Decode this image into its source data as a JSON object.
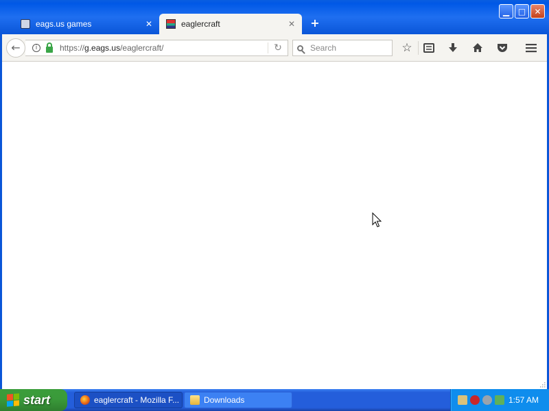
{
  "window": {
    "controls": {
      "minimize": "▁",
      "maximize": "□",
      "close": "✕"
    }
  },
  "tabs": [
    {
      "title": "eags.us games",
      "close": "✕",
      "active": false
    },
    {
      "title": "eaglercraft",
      "close": "✕",
      "active": true
    }
  ],
  "new_tab_label": "+",
  "toolbar": {
    "back_icon": "←",
    "info_icon": "i",
    "url_prefix": "https://",
    "url_domain": "g.eags.us",
    "url_path": "/eaglercraft/",
    "reload_icon": "↻",
    "search_placeholder": "Search",
    "icons": [
      "bookmark-star-icon",
      "reading-list-icon",
      "downloads-icon",
      "home-icon",
      "pocket-icon",
      "menu-icon"
    ]
  },
  "taskbar": {
    "start_label": "start",
    "tasks": [
      {
        "label": "eaglercraft - Mozilla F...",
        "icon": "firefox-icon",
        "active": true
      },
      {
        "label": "Downloads",
        "icon": "folder-icon",
        "active": false
      }
    ],
    "clock": "1:57 AM"
  },
  "colors": {
    "titlebar": "#0058e6",
    "taskbar": "#245edb",
    "start": "#3a9a3a",
    "tray": "#0f8ded",
    "lock": "#3aa547"
  }
}
